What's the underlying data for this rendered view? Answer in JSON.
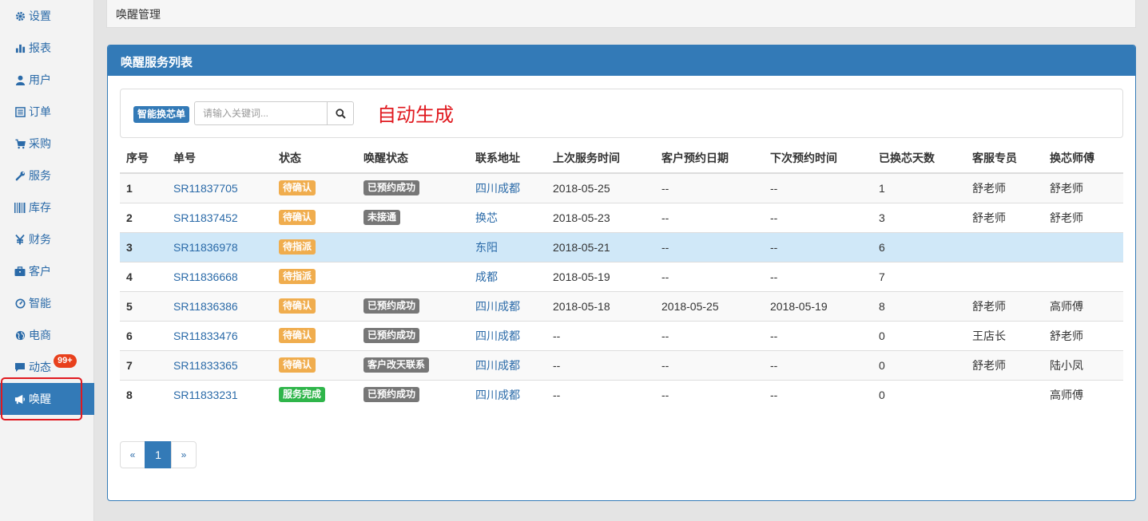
{
  "sidebar": {
    "items": [
      {
        "label": "设置",
        "icon": "gear-icon"
      },
      {
        "label": "报表",
        "icon": "bar-chart-icon"
      },
      {
        "label": "用户",
        "icon": "user-icon"
      },
      {
        "label": "订单",
        "icon": "list-icon"
      },
      {
        "label": "采购",
        "icon": "cart-icon"
      },
      {
        "label": "服务",
        "icon": "wrench-icon"
      },
      {
        "label": "库存",
        "icon": "barcode-icon"
      },
      {
        "label": "财务",
        "icon": "yen-icon"
      },
      {
        "label": "客户",
        "icon": "briefcase-icon"
      },
      {
        "label": "智能",
        "icon": "dashboard-icon"
      },
      {
        "label": "电商",
        "icon": "globe-icon"
      },
      {
        "label": "动态",
        "icon": "comment-icon"
      },
      {
        "label": "唤醒",
        "icon": "bullhorn-icon"
      }
    ],
    "badge": "99+",
    "active_index": 12
  },
  "breadcrumb": "唤醒管理",
  "panel": {
    "title": "唤醒服务列表",
    "tag": "智能换芯单",
    "search_placeholder": "请输入关键词...",
    "annotation": "自动生成"
  },
  "table": {
    "headers": [
      "序号",
      "单号",
      "状态",
      "唤醒状态",
      "联系地址",
      "上次服务时间",
      "客户预约日期",
      "下次预约时间",
      "已换芯天数",
      "客服专员",
      "换芯师傅"
    ],
    "rows": [
      {
        "no": "1",
        "id": "SR11837705",
        "status": "待确认",
        "status_type": "warning",
        "wake": "已预约成功",
        "addr": "四川成都",
        "last": "2018-05-25",
        "appt": "--",
        "next": "--",
        "days": "1",
        "cs": "舒老师",
        "tech": "舒老师"
      },
      {
        "no": "2",
        "id": "SR11837452",
        "status": "待确认",
        "status_type": "warning",
        "wake": "未接通",
        "addr": "换芯",
        "last": "2018-05-23",
        "appt": "--",
        "next": "--",
        "days": "3",
        "cs": "舒老师",
        "tech": "舒老师"
      },
      {
        "no": "3",
        "id": "SR11836978",
        "status": "待指派",
        "status_type": "warning",
        "wake": "",
        "addr": "东阳",
        "last": "2018-05-21",
        "appt": "--",
        "next": "--",
        "days": "6",
        "cs": "",
        "tech": ""
      },
      {
        "no": "4",
        "id": "SR11836668",
        "status": "待指派",
        "status_type": "warning",
        "wake": "",
        "addr": "成都",
        "last": "2018-05-19",
        "appt": "--",
        "next": "--",
        "days": "7",
        "cs": "",
        "tech": ""
      },
      {
        "no": "5",
        "id": "SR11836386",
        "status": "待确认",
        "status_type": "warning",
        "wake": "已预约成功",
        "addr": "四川成都",
        "last": "2018-05-18",
        "appt": "2018-05-25",
        "next": "2018-05-19",
        "days": "8",
        "cs": "舒老师",
        "tech": "高师傅"
      },
      {
        "no": "6",
        "id": "SR11833476",
        "status": "待确认",
        "status_type": "warning",
        "wake": "已预约成功",
        "addr": "四川成都",
        "last": "--",
        "appt": "--",
        "next": "--",
        "days": "0",
        "cs": "王店长",
        "tech": "舒老师"
      },
      {
        "no": "7",
        "id": "SR11833365",
        "status": "待确认",
        "status_type": "warning",
        "wake": "客户改天联系",
        "addr": "四川成都",
        "last": "--",
        "appt": "--",
        "next": "--",
        "days": "0",
        "cs": "舒老师",
        "tech": "陆小凤"
      },
      {
        "no": "8",
        "id": "SR11833231",
        "status": "服务完成",
        "status_type": "success",
        "wake": "已预约成功",
        "addr": "四川成都",
        "last": "--",
        "appt": "--",
        "next": "--",
        "days": "0",
        "cs": "",
        "tech": "高师傅"
      }
    ],
    "highlighted_row": 3
  },
  "pagination": {
    "prev": "«",
    "current": "1",
    "next": "»"
  }
}
